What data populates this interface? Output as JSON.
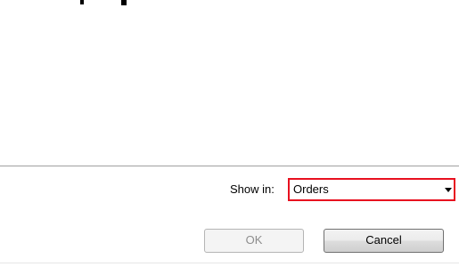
{
  "footer": {
    "show_in_label": "Show in:",
    "show_in_value": "Orders",
    "ok_label": "OK",
    "cancel_label": "Cancel"
  },
  "colors": {
    "highlight_border": "#e8101f",
    "disabled_text": "#8d8d8d"
  },
  "icons": {
    "dropdown": "chevron-down-icon"
  },
  "state": {
    "ok_enabled": false
  }
}
